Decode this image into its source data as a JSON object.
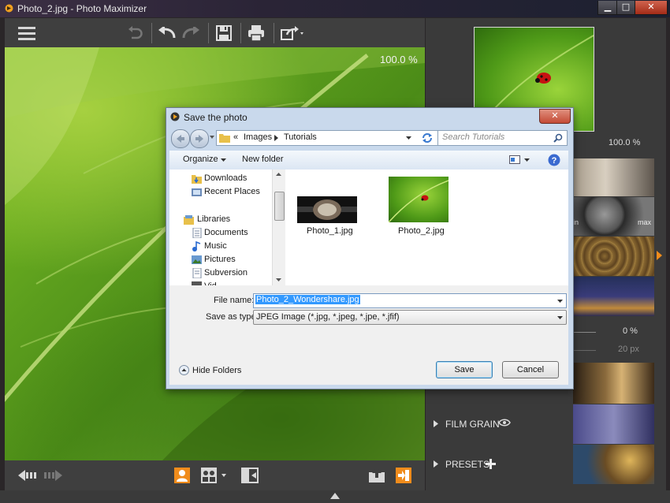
{
  "window": {
    "title": "Photo_2.jpg - Photo Maximizer"
  },
  "canvas": {
    "zoom": "100.0 %"
  },
  "navigator": {
    "zoom": "100.0 %"
  },
  "panel": {
    "labels": {
      "min": "in",
      "max": "max"
    },
    "amount": "0 %",
    "radius": "20 px",
    "film_grain": "FILM GRAIN",
    "presets": "PRESETS"
  },
  "dialog": {
    "title": "Save the photo",
    "breadcrumb": [
      "Images",
      "Tutorials"
    ],
    "search_placeholder": "Search Tutorials",
    "organize": "Organize",
    "new_folder": "New folder",
    "nav_items": [
      {
        "label": "Downloads",
        "icon": "downloads-folder-icon"
      },
      {
        "label": "Recent Places",
        "icon": "recent-places-icon"
      },
      {
        "label": "Libraries",
        "icon": "libraries-icon"
      },
      {
        "label": "Documents",
        "icon": "documents-icon"
      },
      {
        "label": "Music",
        "icon": "music-icon"
      },
      {
        "label": "Pictures",
        "icon": "pictures-icon"
      },
      {
        "label": "Subversion",
        "icon": "subversion-icon"
      },
      {
        "label": "Vid",
        "icon": "videos-icon"
      }
    ],
    "files": [
      {
        "name": "Photo_1.jpg"
      },
      {
        "name": "Photo_2.jpg"
      }
    ],
    "file_name_label": "File name:",
    "file_name_value": "Photo_2_Wondershare.jpg",
    "save_type_label": "Save as type:",
    "save_type_value": "JPEG Image (*.jpg, *.jpeg, *.jpe, *.jfif)",
    "hide_folders": "Hide Folders",
    "save": "Save",
    "cancel": "Cancel"
  },
  "colors": {
    "accent_orange": "#f08c1c",
    "dialog_blue": "#c9d9ec",
    "select_blue": "#3399ff"
  }
}
